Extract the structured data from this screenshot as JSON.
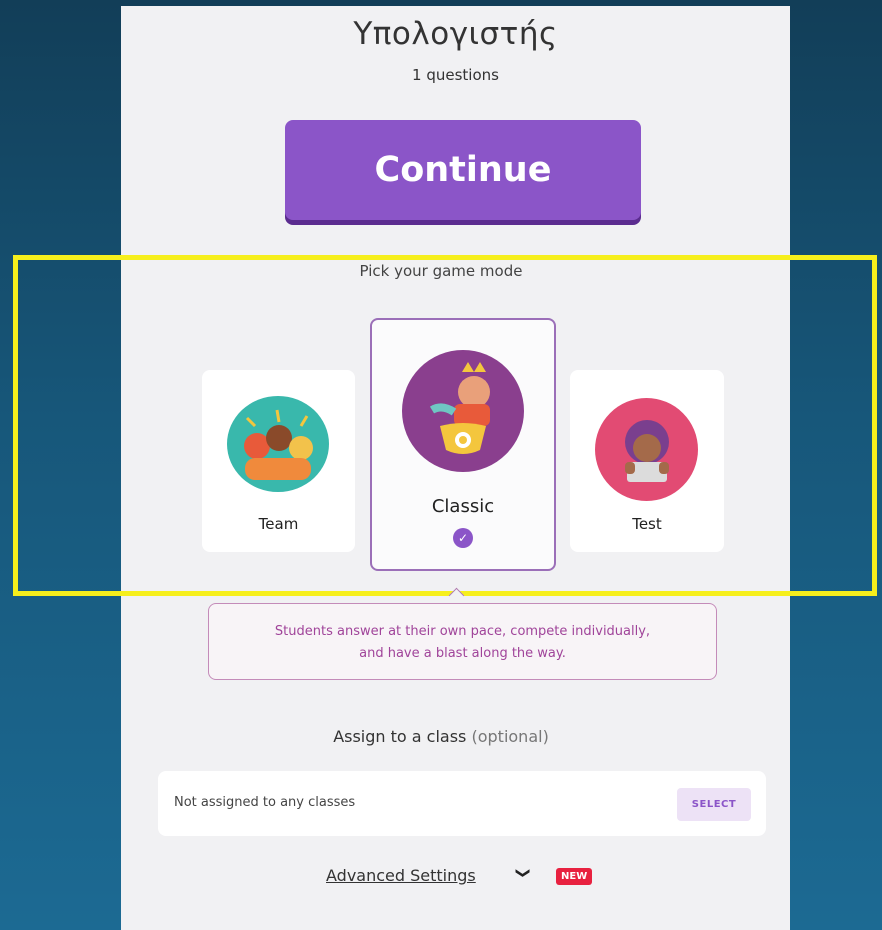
{
  "quiz": {
    "title": "Υπολογιστής",
    "questions": "1 questions"
  },
  "continue_label": "Continue",
  "game_mode": {
    "heading": "Pick your game mode",
    "modes": [
      {
        "label": "Team",
        "icon": "team-illustration-icon"
      },
      {
        "label": "Classic",
        "icon": "classic-illustration-icon",
        "selected": true
      },
      {
        "label": "Test",
        "icon": "test-illustration-icon"
      }
    ],
    "description_line1": "Students answer at their own pace, compete individually,",
    "description_line2": "and have a blast along the way."
  },
  "assign": {
    "label": "Assign to a class",
    "optional": "(optional)",
    "status": "Not assigned to any classes",
    "select_label": "SELECT"
  },
  "advanced": {
    "label": "Advanced Settings",
    "badge": "NEW"
  },
  "colors": {
    "accent": "#8b55c8",
    "highlight": "#f6ef1c",
    "badge": "#e8213f"
  }
}
